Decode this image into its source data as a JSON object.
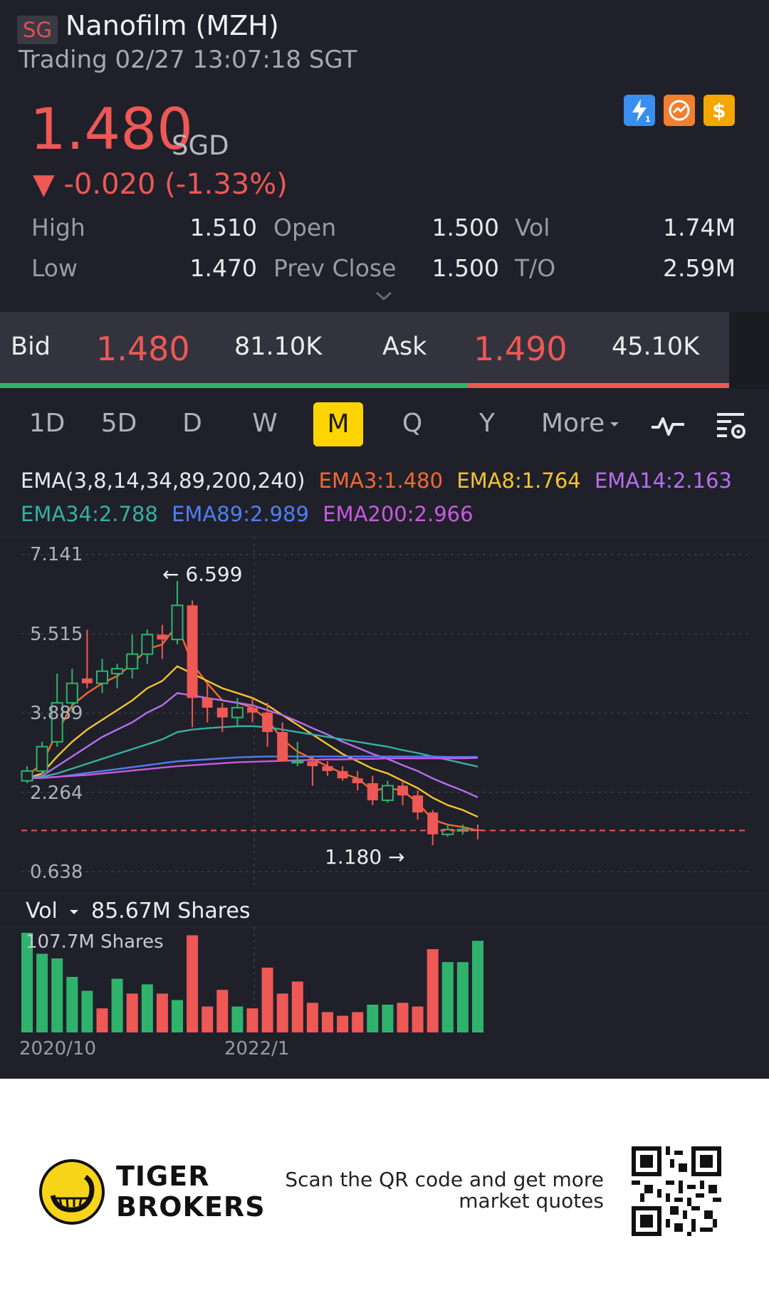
{
  "header": {
    "country_tag": "SG",
    "title": "Nanofilm (MZH)",
    "status": "Trading 02/27 13:07:18 SGT",
    "price": "1.480",
    "currency": "SGD",
    "change": "▼ -0.020 (-1.33%)"
  },
  "quick_icons": [
    {
      "icon": "lightning-icon",
      "color": "#3a8ef0"
    },
    {
      "icon": "trend-icon",
      "color": "#f08030"
    },
    {
      "icon": "dollar-icon",
      "color": "#f5a600"
    }
  ],
  "stats": {
    "high_label": "High",
    "high": "1.510",
    "low_label": "Low",
    "low": "1.470",
    "open_label": "Open",
    "open": "1.500",
    "prev_close_label": "Prev Close",
    "prev_close": "1.500",
    "vol_label": "Vol",
    "vol": "1.74M",
    "turnover_label": "T/O",
    "turnover": "2.59M"
  },
  "orderbook": {
    "bid_label": "Bid",
    "bid_price": "1.480",
    "bid_qty": "81.10K",
    "ask_label": "Ask",
    "ask_price": "1.490",
    "ask_qty": "45.10K"
  },
  "periods": [
    "1D",
    "5D",
    "D",
    "W",
    "M",
    "Q",
    "Y"
  ],
  "active_period": "M",
  "more_label": "More",
  "ema": {
    "label": "EMA(3,8,14,34,89,200,240)",
    "ema3": "EMA3:1.480",
    "ema8": "EMA8:1.764",
    "ema14": "EMA14:2.163",
    "ema34": "EMA34:2.788",
    "ema89": "EMA89:2.989",
    "ema200": "EMA200:2.966",
    "colors": {
      "ema3": "#f06a30",
      "ema8": "#f5c430",
      "ema14": "#b86ef0",
      "ema34": "#36b0a0",
      "ema89": "#4f7ef0",
      "ema200": "#c85ae0"
    }
  },
  "volume": {
    "label": "Vol",
    "value": "85.67M Shares",
    "max_label": "107.7M Shares"
  },
  "chart_data": {
    "type": "candlestick",
    "y_ticks": [
      "7.141",
      "5.515",
      "3.889",
      "2.264",
      "0.638"
    ],
    "ylim": [
      0.638,
      7.141
    ],
    "x_ticks": [
      "2020/10",
      "2022/1"
    ],
    "current_price_line": 1.48,
    "high_marker": "6.599",
    "low_marker": "1.180",
    "candles": [
      {
        "o": 2.5,
        "h": 2.8,
        "l": 2.45,
        "c": 2.7
      },
      {
        "o": 2.7,
        "h": 3.3,
        "l": 2.6,
        "c": 3.2
      },
      {
        "o": 3.3,
        "h": 4.7,
        "l": 3.2,
        "c": 4.1
      },
      {
        "o": 4.1,
        "h": 4.8,
        "l": 3.9,
        "c": 4.5
      },
      {
        "o": 4.6,
        "h": 5.6,
        "l": 4.4,
        "c": 4.5
      },
      {
        "o": 4.5,
        "h": 5.0,
        "l": 4.3,
        "c": 4.75
      },
      {
        "o": 4.7,
        "h": 4.9,
        "l": 4.4,
        "c": 4.8
      },
      {
        "o": 4.8,
        "h": 5.5,
        "l": 4.6,
        "c": 5.1
      },
      {
        "o": 5.1,
        "h": 5.6,
        "l": 4.9,
        "c": 5.5
      },
      {
        "o": 5.5,
        "h": 5.7,
        "l": 5.0,
        "c": 5.4
      },
      {
        "o": 5.4,
        "h": 6.6,
        "l": 5.3,
        "c": 6.1
      },
      {
        "o": 6.1,
        "h": 6.2,
        "l": 3.6,
        "c": 4.2
      },
      {
        "o": 4.2,
        "h": 4.5,
        "l": 3.7,
        "c": 4.0
      },
      {
        "o": 4.0,
        "h": 4.1,
        "l": 3.5,
        "c": 3.8
      },
      {
        "o": 3.8,
        "h": 4.2,
        "l": 3.6,
        "c": 4.0
      },
      {
        "o": 4.0,
        "h": 4.2,
        "l": 3.7,
        "c": 3.9
      },
      {
        "o": 3.9,
        "h": 4.1,
        "l": 3.2,
        "c": 3.5
      },
      {
        "o": 3.5,
        "h": 3.7,
        "l": 2.9,
        "c": 2.9
      },
      {
        "o": 2.9,
        "h": 3.3,
        "l": 2.8,
        "c": 2.9
      },
      {
        "o": 2.9,
        "h": 3.0,
        "l": 2.4,
        "c": 2.8
      },
      {
        "o": 2.8,
        "h": 2.9,
        "l": 2.6,
        "c": 2.7
      },
      {
        "o": 2.7,
        "h": 2.8,
        "l": 2.5,
        "c": 2.55
      },
      {
        "o": 2.55,
        "h": 2.7,
        "l": 2.3,
        "c": 2.45
      },
      {
        "o": 2.45,
        "h": 2.6,
        "l": 2.0,
        "c": 2.1
      },
      {
        "o": 2.1,
        "h": 2.5,
        "l": 2.05,
        "c": 2.4
      },
      {
        "o": 2.4,
        "h": 2.5,
        "l": 2.0,
        "c": 2.2
      },
      {
        "o": 2.2,
        "h": 2.3,
        "l": 1.7,
        "c": 1.85
      },
      {
        "o": 1.85,
        "h": 1.9,
        "l": 1.18,
        "c": 1.4
      },
      {
        "o": 1.4,
        "h": 1.6,
        "l": 1.35,
        "c": 1.5
      },
      {
        "o": 1.5,
        "h": 1.6,
        "l": 1.4,
        "c": 1.5
      },
      {
        "o": 1.5,
        "h": 1.6,
        "l": 1.3,
        "c": 1.48
      }
    ],
    "ema_lines": {
      "ema3": [
        2.6,
        2.85,
        3.5,
        4.05,
        4.3,
        4.5,
        4.65,
        4.9,
        5.2,
        5.3,
        5.7,
        4.9,
        4.5,
        4.15,
        4.1,
        4.0,
        3.75,
        3.35,
        3.1,
        2.95,
        2.8,
        2.65,
        2.55,
        2.3,
        2.35,
        2.3,
        2.05,
        1.7,
        1.6,
        1.55,
        1.48
      ],
      "ema8": [
        2.55,
        2.65,
        3.0,
        3.3,
        3.55,
        3.75,
        3.95,
        4.15,
        4.4,
        4.55,
        4.85,
        4.7,
        4.55,
        4.4,
        4.3,
        4.2,
        4.05,
        3.85,
        3.65,
        3.45,
        3.25,
        3.05,
        2.9,
        2.75,
        2.65,
        2.5,
        2.35,
        2.15,
        2.0,
        1.9,
        1.76
      ],
      "ema14": [
        2.55,
        2.6,
        2.8,
        3.0,
        3.2,
        3.4,
        3.55,
        3.7,
        3.9,
        4.05,
        4.3,
        4.25,
        4.2,
        4.15,
        4.1,
        4.05,
        3.95,
        3.85,
        3.72,
        3.58,
        3.45,
        3.3,
        3.18,
        3.05,
        2.95,
        2.82,
        2.7,
        2.55,
        2.42,
        2.3,
        2.16
      ],
      "ema34": [
        2.55,
        2.58,
        2.65,
        2.75,
        2.85,
        2.95,
        3.05,
        3.15,
        3.25,
        3.35,
        3.5,
        3.55,
        3.58,
        3.6,
        3.62,
        3.62,
        3.6,
        3.55,
        3.5,
        3.45,
        3.4,
        3.35,
        3.3,
        3.25,
        3.2,
        3.13,
        3.07,
        3.0,
        2.93,
        2.86,
        2.79
      ],
      "ema89": [
        2.55,
        2.56,
        2.58,
        2.62,
        2.66,
        2.7,
        2.74,
        2.78,
        2.82,
        2.86,
        2.9,
        2.92,
        2.94,
        2.96,
        2.98,
        2.99,
        3.0,
        3.0,
        3.0,
        3.0,
        3.0,
        3.0,
        3.0,
        3.0,
        3.0,
        3.0,
        3.0,
        3.0,
        2.99,
        2.99,
        2.99
      ],
      "ema200": [
        2.55,
        2.56,
        2.58,
        2.6,
        2.62,
        2.65,
        2.68,
        2.71,
        2.74,
        2.77,
        2.8,
        2.82,
        2.84,
        2.86,
        2.88,
        2.89,
        2.9,
        2.91,
        2.92,
        2.93,
        2.94,
        2.94,
        2.95,
        2.95,
        2.96,
        2.96,
        2.96,
        2.96,
        2.96,
        2.96,
        2.97
      ]
    },
    "volumes": [
      107.7,
      85,
      80,
      60,
      45,
      26,
      58,
      42,
      52,
      42,
      35,
      105,
      28,
      46,
      28,
      26,
      70,
      42,
      55,
      32,
      22,
      18,
      22,
      30,
      30,
      32,
      28,
      90,
      76,
      76,
      99
    ],
    "volume_up": [
      true,
      true,
      true,
      true,
      true,
      false,
      true,
      false,
      true,
      false,
      true,
      false,
      false,
      false,
      true,
      false,
      false,
      false,
      false,
      false,
      false,
      false,
      false,
      true,
      true,
      false,
      false,
      false,
      true,
      true,
      true
    ]
  },
  "footer": {
    "brand_line1": "TIGER",
    "brand_line2": "BROKERS",
    "scan_line1": "Scan the QR code and get more",
    "scan_line2": "market quotes"
  }
}
